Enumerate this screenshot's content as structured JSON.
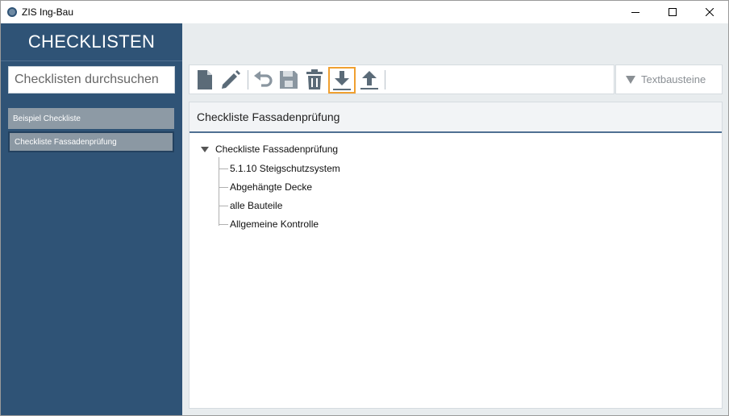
{
  "window": {
    "title": "ZIS Ing-Bau"
  },
  "sidebar": {
    "header": "CHECKLISTEN",
    "search_placeholder": "Checklisten durchsuchen",
    "items": [
      {
        "label": "Beispiel Checkliste"
      },
      {
        "label": "Checkliste Fassadenprüfung",
        "selected": true
      }
    ]
  },
  "toolbar": {
    "buttons": [
      "new-document-icon",
      "edit-pencil-icon",
      "undo-icon",
      "save-icon",
      "delete-trash-icon",
      "download-icon",
      "upload-icon"
    ],
    "highlighted": "download-icon",
    "dropdown_label": "Textbausteine"
  },
  "panel": {
    "title": "Checkliste Fassadenprüfung",
    "tree": {
      "root": "Checkliste Fassadenprüfung",
      "children": [
        "5.1.10 Steigschutzsystem",
        "Abgehängte Decke",
        "alle Bauteile",
        "Allgemeine Kontrolle"
      ]
    }
  },
  "colors": {
    "sidebar": "#2f5376",
    "highlight": "#f0a030",
    "icon": "#5b6b78"
  }
}
